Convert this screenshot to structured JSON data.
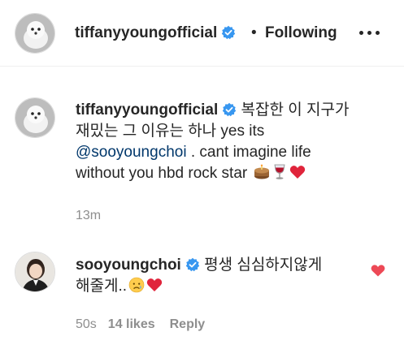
{
  "header": {
    "username": "tiffanyyoungofficial",
    "separator": "•",
    "follow_status": "Following"
  },
  "caption": {
    "username": "tiffanyyoungofficial",
    "text_line1": "복잡한 이 지구가",
    "text_line2": "재밌는 그 이유는 하나 yes its",
    "mention": "@sooyoungchoi",
    "text_line3_rest": " . cant imagine life",
    "text_line4": "without you hbd rock star",
    "emojis": [
      "cake-emoji",
      "wine-glass-emoji",
      "red-heart-emoji"
    ],
    "time": "13m"
  },
  "comment": {
    "username": "sooyoungchoi",
    "text_line1": "평생 심심하지않게",
    "text_line2": "해줄게..",
    "emojis": [
      "crying-face-emoji",
      "red-heart-emoji"
    ],
    "time": "50s",
    "likes": "14 likes",
    "reply_label": "Reply",
    "liked": true
  },
  "colors": {
    "verified_blue": "#3897f0",
    "heart_red": "#ed4956",
    "mention": "#00376b",
    "meta_gray": "#8e8e8e"
  }
}
